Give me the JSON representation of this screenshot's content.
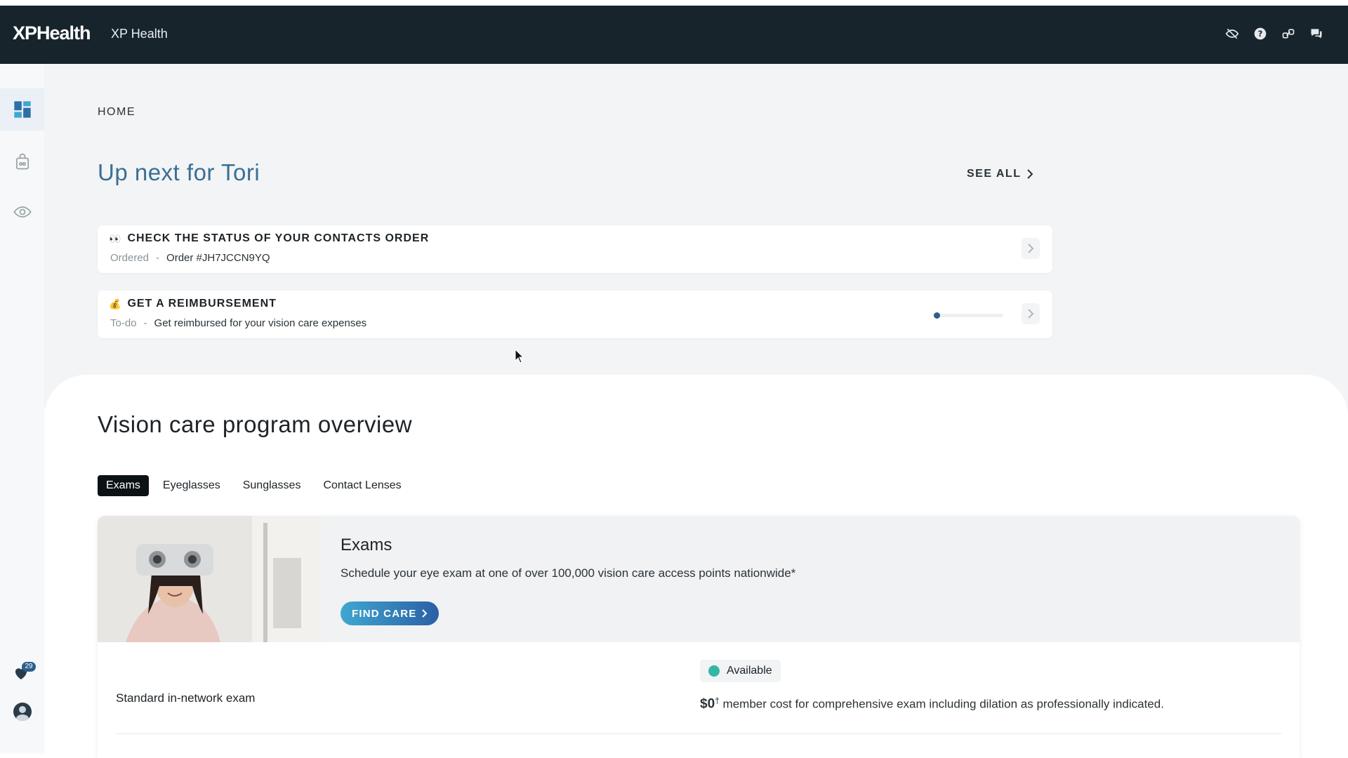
{
  "topbar": {
    "logo": "XPHealth",
    "app_name": "XP Health",
    "icons": [
      "eye-slash-icon",
      "help-icon",
      "link-icon",
      "chat-icon"
    ]
  },
  "sidebar": {
    "items": [
      {
        "name": "dashboard-icon",
        "active": true
      },
      {
        "name": "shopping-bag-icon",
        "active": false
      },
      {
        "name": "eye-icon",
        "active": false
      }
    ],
    "notifications_badge": "29",
    "avatar": "avatar-icon"
  },
  "main": {
    "breadcrumb": "HOME",
    "up_next_title": "Up next for Tori",
    "see_all_label": "SEE ALL",
    "tasks": [
      {
        "emoji": "👀",
        "title": "CHECK THE STATUS OF YOUR CONTACTS ORDER",
        "status": "Ordered",
        "separator": "-",
        "description": "Order #JH7JCCN9YQ"
      },
      {
        "emoji": "💰",
        "title": "GET A REIMBURSEMENT",
        "status": "To-do",
        "separator": "-",
        "description": "Get reimbursed for your vision care expenses",
        "progress": 0.05
      }
    ]
  },
  "overview": {
    "title": "Vision care program overview",
    "tabs": [
      {
        "label": "Exams",
        "active": true
      },
      {
        "label": "Eyeglasses",
        "active": false
      },
      {
        "label": "Sunglasses",
        "active": false
      },
      {
        "label": "Contact Lenses",
        "active": false
      }
    ],
    "benefit": {
      "title": "Exams",
      "description": "Schedule your eye exam at one of over 100,000 vision care access points nationwide*",
      "cta": "FIND CARE",
      "row": {
        "label": "Standard in-network exam",
        "status": "Available",
        "price": "$0",
        "price_mark": "†",
        "cost_text": " member cost for comprehensive exam including dilation as professionally indicated."
      }
    }
  },
  "colors": {
    "topbar": "#17242c",
    "accent": "#3b6f93",
    "available": "#35b5a6"
  }
}
